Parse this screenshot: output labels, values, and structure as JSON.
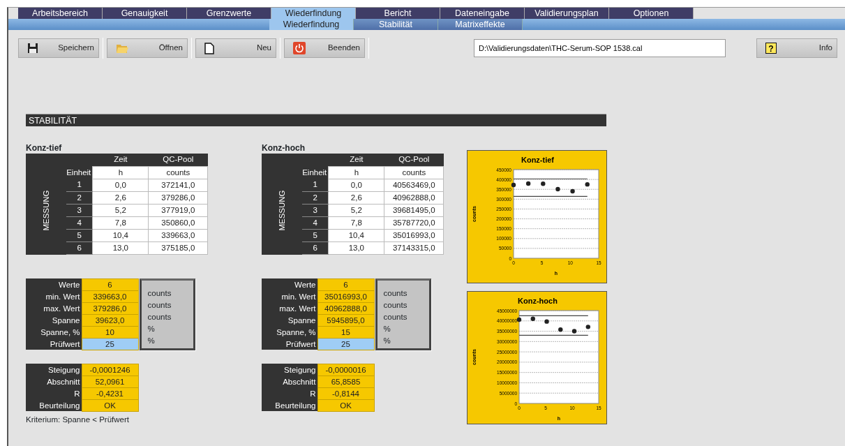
{
  "tabs": [
    {
      "label": "Arbeitsbereich",
      "selected": false
    },
    {
      "label": "Genauigkeit",
      "selected": false
    },
    {
      "label": "Grenzwerte",
      "selected": false
    },
    {
      "label": "Wiederfindung",
      "selected": true
    },
    {
      "label": "Bericht",
      "selected": false
    },
    {
      "label": "Dateneingabe",
      "selected": false
    },
    {
      "label": "Validierungsplan",
      "selected": false
    },
    {
      "label": "Optionen",
      "selected": false
    }
  ],
  "subtabs": [
    {
      "label": "Wiederfindung",
      "selected": true
    },
    {
      "label": "Stabilität",
      "selected": false
    },
    {
      "label": "Matrixeffekte",
      "selected": false
    }
  ],
  "toolbar": {
    "buttons": [
      {
        "label": "Speichern",
        "kind": "save"
      },
      {
        "label": "Öffnen",
        "kind": "open"
      },
      {
        "label": "Neu",
        "kind": "new"
      },
      {
        "label": "Beenden",
        "kind": "exit"
      }
    ],
    "file_path": "D:\\Validierungsdaten\\THC-Serum-SOP 1538.cal",
    "info_icon": "?",
    "info_button": "Info"
  },
  "section_title": "STABILITÄT",
  "panels": [
    {
      "title": "Konz-tief",
      "table": {
        "columns": [
          "Zeit",
          "QC-Pool"
        ],
        "unit_label": "Einheit",
        "units": [
          "h",
          "counts"
        ],
        "row_header": "MESSUNG",
        "rows": [
          {
            "index": "1",
            "cells": [
              "0,0",
              "372141,0"
            ]
          },
          {
            "index": "2",
            "cells": [
              "2,6",
              "379286,0"
            ]
          },
          {
            "index": "3",
            "cells": [
              "5,2",
              "377919,0"
            ]
          },
          {
            "index": "4",
            "cells": [
              "7,8",
              "350860,0"
            ]
          },
          {
            "index": "5",
            "cells": [
              "10,4",
              "339663,0"
            ]
          },
          {
            "index": "6",
            "cells": [
              "13,0",
              "375185,0"
            ]
          }
        ]
      },
      "stats": [
        {
          "label": "Werte",
          "value": "6",
          "kind": "result"
        },
        {
          "label": "min. Wert",
          "value": "339663,0",
          "unit": "counts",
          "kind": "result"
        },
        {
          "label": "max. Wert",
          "value": "379286,0",
          "unit": "counts",
          "kind": "result"
        },
        {
          "label": "Spanne",
          "value": "39623,0",
          "unit": "counts",
          "kind": "result"
        },
        {
          "label": "Spanne, %",
          "value": "10",
          "unit": "%",
          "kind": "result"
        },
        {
          "label": "Prüfwert",
          "value": "25",
          "unit": "%",
          "kind": "input"
        }
      ],
      "regression": [
        {
          "label": "Steigung",
          "value": "-0,0001246"
        },
        {
          "label": "Abschnitt",
          "value": "52,0961"
        },
        {
          "label": "R",
          "value": "-0,4231"
        },
        {
          "label": "Beurteilung",
          "value": "OK"
        }
      ],
      "note": "Kriterium: Spanne < Prüfwert"
    },
    {
      "title": "Konz-hoch",
      "table": {
        "columns": [
          "Zeit",
          "QC-Pool"
        ],
        "unit_label": "Einheit",
        "units": [
          "h",
          "counts"
        ],
        "row_header": "MESSUNG",
        "rows": [
          {
            "index": "1",
            "cells": [
              "0,0",
              "40563469,0"
            ]
          },
          {
            "index": "2",
            "cells": [
              "2,6",
              "40962888,0"
            ]
          },
          {
            "index": "3",
            "cells": [
              "5,2",
              "39681495,0"
            ]
          },
          {
            "index": "4",
            "cells": [
              "7,8",
              "35787720,0"
            ]
          },
          {
            "index": "5",
            "cells": [
              "10,4",
              "35016993,0"
            ]
          },
          {
            "index": "6",
            "cells": [
              "13,0",
              "37143315,0"
            ]
          }
        ]
      },
      "stats": [
        {
          "label": "Werte",
          "value": "6",
          "kind": "result"
        },
        {
          "label": "min. Wert",
          "value": "35016993,0",
          "unit": "counts",
          "kind": "result"
        },
        {
          "label": "max. Wert",
          "value": "40962888,0",
          "unit": "counts",
          "kind": "result"
        },
        {
          "label": "Spanne",
          "value": "5945895,0",
          "unit": "counts",
          "kind": "result"
        },
        {
          "label": "Spanne, %",
          "value": "15",
          "unit": "%",
          "kind": "result"
        },
        {
          "label": "Prüfwert",
          "value": "25",
          "unit": "%",
          "kind": "input"
        }
      ],
      "regression": [
        {
          "label": "Steigung",
          "value": "-0,0000016"
        },
        {
          "label": "Abschnitt",
          "value": "65,8585"
        },
        {
          "label": "R",
          "value": "-0,8144"
        },
        {
          "label": "Beurteilung",
          "value": "OK"
        }
      ]
    }
  ],
  "charts": [
    {
      "chart_data": {
        "type": "scatter",
        "title": "Konz-tief",
        "xlabel": "h",
        "ylabel": "counts",
        "x": [
          0,
          2.6,
          5.2,
          7.8,
          10.4,
          13
        ],
        "series": [
          {
            "color": "#222222",
            "values": [
              372000,
              379000,
              378000,
              351000,
              340000,
              375000
            ]
          }
        ],
        "xlim": [
          0,
          15
        ],
        "ylim": [
          0,
          450000
        ],
        "xticks": [
          0,
          5,
          10,
          15
        ],
        "yticks": [
          0,
          50000,
          100000,
          150000,
          200000,
          250000,
          300000,
          350000,
          400000,
          450000
        ],
        "grid": true,
        "ref_lines": [
          {
            "axis": "y",
            "value": 403000
          },
          {
            "axis": "y",
            "value": 314000
          }
        ]
      }
    },
    {
      "chart_data": {
        "type": "scatter",
        "title": "Konz-hoch",
        "xlabel": "h",
        "ylabel": "counts",
        "x": [
          0,
          2.6,
          5.2,
          7.8,
          10.4,
          13
        ],
        "series": [
          {
            "color": "#222222",
            "values": [
              40600000,
              41000000,
              39700000,
              35800000,
              35000000,
              37100000
            ]
          }
        ],
        "xlim": [
          0,
          15
        ],
        "ylim": [
          0,
          45000000
        ],
        "xticks": [
          0,
          5,
          10,
          15
        ],
        "yticks": [
          0,
          5000000,
          10000000,
          15000000,
          20000000,
          25000000,
          30000000,
          35000000,
          40000000,
          45000000
        ],
        "grid": true,
        "ref_lines": [
          {
            "axis": "y",
            "value": 42500000
          },
          {
            "axis": "y",
            "value": 33000000
          }
        ]
      }
    }
  ]
}
